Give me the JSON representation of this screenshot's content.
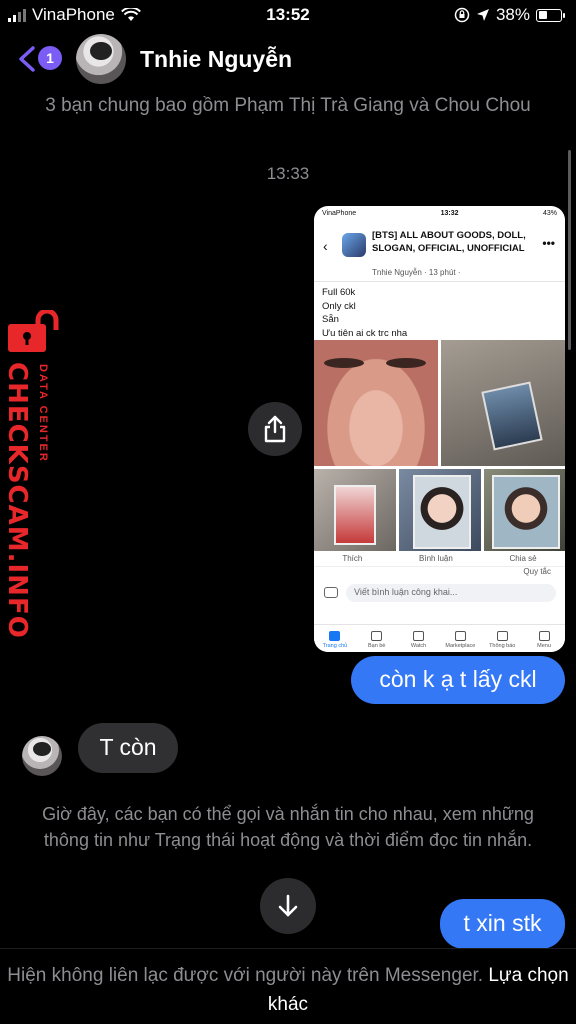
{
  "status_bar": {
    "carrier": "VinaPhone",
    "time": "13:52",
    "battery": "38%",
    "battery_level": 0.38
  },
  "header": {
    "unread_badge": "1",
    "contact_name": "Tnhie Nguyễn"
  },
  "mutual_friends": "3 bạn chung bao gồm Phạm Thị Trà Giang và Chou Chou",
  "timestamp": "13:33",
  "shared_screenshot": {
    "carrier": "VinaPhone",
    "time": "13:32",
    "battery": "43%",
    "group_name": "[BTS] ALL ABOUT GOODS, DOLL, SLOGAN, OFFICIAL, UNOFFICIAL",
    "post_author": "Tnhie Nguyễn · 13 phút ·",
    "post_lines": [
      "Full 60k",
      "Only ckl",
      "Sẵn",
      "Ưu tiên ai ck trc nha"
    ],
    "actions": [
      "Thích",
      "Bình luận",
      "Chia sẻ"
    ],
    "rules_link": "Quy tắc",
    "comment_placeholder": "Viết bình luận công khai...",
    "tabs": [
      "Trang chủ",
      "Bạn bè",
      "Watch",
      "Marketplace",
      "Thông báo",
      "Menu"
    ]
  },
  "messages": {
    "outgoing_1": "còn k ạ t lấy ckl",
    "incoming_1": "T còn",
    "outgoing_2": "t xin stk"
  },
  "info_notice": "Giờ đây, các bạn có thể gọi và nhắn tin cho nhau, xem những thông tin như Trạng thái hoạt động và thời điểm đọc tin nhắn.",
  "footer": {
    "text": "Hiện không liên lạc được với người này trên Messenger.",
    "link": "Lựa chọn khác"
  },
  "watermark": {
    "brand": "CHECKSCAM.INFO",
    "sub": "DATA CENTER"
  },
  "colors": {
    "accent": "#7b5cf5",
    "bubble_out": "#3478f6",
    "bubble_in": "#303033",
    "watermark": "#e8272b"
  }
}
